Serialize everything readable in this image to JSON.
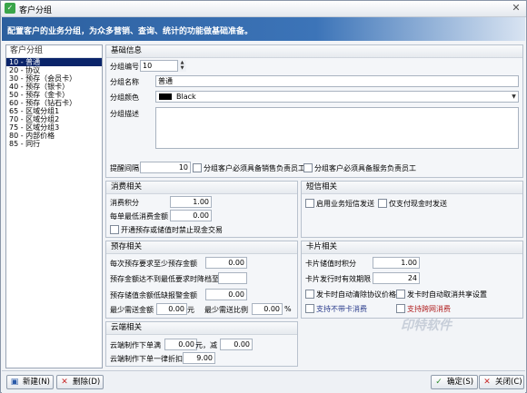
{
  "window": {
    "title": "客户分组",
    "close_glyph": "✕"
  },
  "banner": {
    "text": "配置客户的业务分组，为众多营销、查询、统计的功能做基础准备。"
  },
  "sidebar": {
    "header": "客户分组",
    "items": [
      {
        "label": "10 - 普通",
        "selected": true
      },
      {
        "label": "20 - 协议"
      },
      {
        "label": "30 - 预存（会员卡）"
      },
      {
        "label": "40 - 预存（银卡）"
      },
      {
        "label": "50 - 预存（金卡）"
      },
      {
        "label": "60 - 预存（钻石卡）"
      },
      {
        "label": "65 - 区域分组1"
      },
      {
        "label": "70 - 区域分组2"
      },
      {
        "label": "75 - 区域分组3"
      },
      {
        "label": "80 - 内部价格"
      },
      {
        "label": "85 - 同行"
      }
    ]
  },
  "basic": {
    "header": "基础信息",
    "code_label": "分组编号",
    "code_value": "10",
    "name_label": "分组名称",
    "name_value": "普通",
    "color_label": "分组颜色",
    "color_value": "Black",
    "color_hex": "#000000",
    "desc_label": "分组描述",
    "desc_value": "",
    "remind_label": "提醒间隔",
    "remind_value": "10",
    "chk_sales_owner": "分组客户必须具备销售负责员工",
    "chk_service_owner": "分组客户必须具备服务负责员工"
  },
  "consume": {
    "header": "消费相关",
    "points_label": "消费积分",
    "points_value": "1.00",
    "min_label": "每单最低消费金额",
    "min_value": "0.00",
    "chk_block": "开通预存或储值时禁止现金交易"
  },
  "sms": {
    "header": "短信相关",
    "chk_enable": "启用业务短信发送",
    "chk_cash_only": "仅支付现金时发送"
  },
  "prepay": {
    "header": "预存相关",
    "each_label": "每次预存要求至少预存金额",
    "each_value": "0.00",
    "expire_label": "预存金额达不到最低要求时降档至",
    "expire_value": "",
    "warn_label": "预存储值余额低缺报警金额",
    "warn_value": "0.00",
    "min_deposit_label": "最少需送金额",
    "min_deposit_value": "0.00",
    "unit_yuan": "元",
    "ratio_label": "最少需送比例",
    "ratio_value": "0.00",
    "unit_pct": "%"
  },
  "card": {
    "header": "卡片相关",
    "points_label": "卡片储值时积分",
    "points_value": "1.00",
    "valid_label": "卡片发行时有效期限",
    "valid_value": "24",
    "chk_auto_delete": "发卡时自动清除协议价格",
    "chk_auto_cancel": "发卡时自动取消共享设置",
    "chk_no_card": "支持不带卡消费",
    "chk_cross": "支持跨网消费"
  },
  "cloud": {
    "header": "云端相关",
    "full_label": "云端制作下单满",
    "full_value": "0.00",
    "unit_yuan_minus": "元，减",
    "minus_value": "0.00",
    "discount_label": "云端制作下单一律折扣",
    "discount_value": "9.00"
  },
  "watermark": "印特软件",
  "footer": {
    "new_label": "新建(N)",
    "delete_label": "删除(D)",
    "ok_label": "确定(S)",
    "close_label": "关闭(C)"
  }
}
